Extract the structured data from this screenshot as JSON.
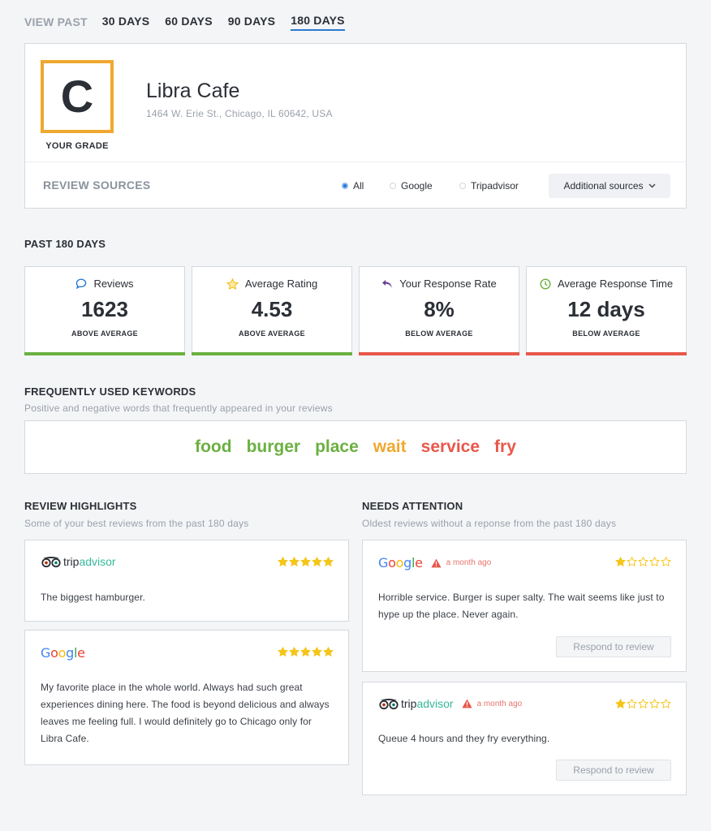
{
  "tabs": {
    "lead": "VIEW PAST",
    "items": [
      {
        "label": "30 DAYS",
        "active": false
      },
      {
        "label": "60 DAYS",
        "active": false
      },
      {
        "label": "90 DAYS",
        "active": false
      },
      {
        "label": "180 DAYS",
        "active": true
      }
    ]
  },
  "business": {
    "grade": "C",
    "grade_label": "YOUR GRADE",
    "name": "Libra Cafe",
    "address": "1464 W. Erie St., Chicago, IL 60642, USA",
    "grade_color": "#f0a830"
  },
  "review_sources": {
    "label": "REVIEW SOURCES",
    "options": [
      {
        "label": "All",
        "selected": true
      },
      {
        "label": "Google",
        "selected": false
      },
      {
        "label": "Tripadvisor",
        "selected": false
      }
    ],
    "additional_label": "Additional sources",
    "additional_icon": "chevron-down-icon"
  },
  "period": {
    "title": "PAST 180 DAYS",
    "stats": [
      {
        "icon": "chat-bubble-icon",
        "title": "Reviews",
        "value": "1623",
        "note": "ABOVE AVERAGE",
        "status_color": "#6bb041"
      },
      {
        "icon": "star-outline-icon",
        "title": "Average Rating",
        "value": "4.53",
        "note": "ABOVE AVERAGE",
        "status_color": "#6bb041"
      },
      {
        "icon": "reply-arrow-icon",
        "title": "Your Response Rate",
        "value": "8%",
        "note": "BELOW AVERAGE",
        "status_color": "#e8574a"
      },
      {
        "icon": "clock-icon",
        "title": "Average Response Time",
        "value": "12 days",
        "note": "BELOW AVERAGE",
        "status_color": "#e8574a"
      }
    ]
  },
  "keywords": {
    "title": "FREQUENTLY USED KEYWORDS",
    "subtitle": "Positive and negative words that frequently appeared in your reviews",
    "items": [
      {
        "word": "food",
        "color": "#6bb041"
      },
      {
        "word": "burger",
        "color": "#6bb041"
      },
      {
        "word": "place",
        "color": "#6bb041"
      },
      {
        "word": "wait",
        "color": "#f0a830"
      },
      {
        "word": "service",
        "color": "#e8574a"
      },
      {
        "word": "fry",
        "color": "#e8574a"
      }
    ]
  },
  "highlights": {
    "title": "REVIEW HIGHLIGHTS",
    "subtitle": "Some of your best reviews from the past 180 days",
    "reviews": [
      {
        "source": "tripadvisor",
        "rating": 5,
        "text": "The biggest hamburger."
      },
      {
        "source": "google",
        "rating": 5,
        "text": "My favorite place in the whole world. Always had such great experiences dining here. The food is beyond delicious and always leaves me feeling full. I would definitely go to Chicago only for Libra Cafe."
      }
    ]
  },
  "attention": {
    "title": "NEEDS ATTENTION",
    "subtitle": "Oldest reviews without a reponse from the past 180 days",
    "reviews": [
      {
        "source": "google",
        "age": "a month ago",
        "rating": 1,
        "text": "Horrible service. Burger is super salty. The wait seems like just to hype up the place. Never again.",
        "button": "Respond to review"
      },
      {
        "source": "tripadvisor",
        "age": "a month ago",
        "rating": 1,
        "text": "Queue 4 hours and they fry everything.",
        "button": "Respond to review"
      }
    ]
  },
  "logos": {
    "google": [
      "G",
      "o",
      "o",
      "g",
      "l",
      "e"
    ],
    "google_colors": [
      "#4285f4",
      "#ea4335",
      "#fbbc05",
      "#4285f4",
      "#34a853",
      "#ea4335"
    ],
    "trip_a": "trip",
    "trip_b": "advisor"
  },
  "colors": {
    "accent": "#2a7ad3",
    "star": "#f5c518"
  }
}
